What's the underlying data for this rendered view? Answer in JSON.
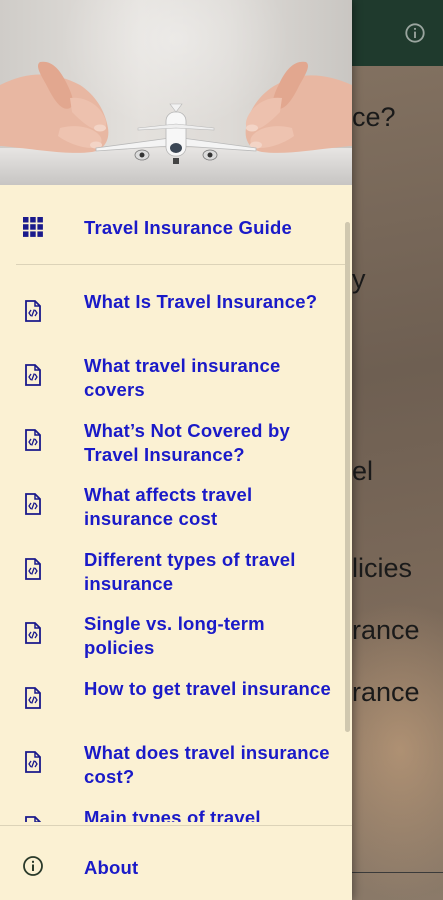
{
  "background": {
    "lines": [
      "ce?",
      "y",
      "el",
      "licies",
      "rance",
      "rance"
    ]
  },
  "drawer": {
    "header_image": "hands-protecting-airplane",
    "guide_item": {
      "label": "Travel Insurance Guide",
      "icon": "grid-icon"
    },
    "items": [
      {
        "label": "What Is Travel Insurance?",
        "icon": "code-file-icon"
      },
      {
        "label": "What travel insurance covers",
        "icon": "code-file-icon"
      },
      {
        "label": "What’s Not Covered by Travel Insurance?",
        "icon": "code-file-icon"
      },
      {
        "label": "What affects travel insurance cost",
        "icon": "code-file-icon"
      },
      {
        "label": "Different types of travel insurance",
        "icon": "code-file-icon"
      },
      {
        "label": "Single vs. long-term policies",
        "icon": "code-file-icon"
      },
      {
        "label": "How to get travel insurance",
        "icon": "code-file-icon"
      },
      {
        "label": "What does travel insurance cost?",
        "icon": "code-file-icon"
      },
      {
        "label": "Main types of travel",
        "icon": "code-file-icon"
      }
    ],
    "about_item": {
      "label": "About",
      "icon": "info-icon"
    }
  },
  "colors": {
    "drawer_bg": "#fbf1d3",
    "link_text": "#1a1ac8",
    "icon": "#1a1a8c",
    "appbar": "#1f3a2d"
  }
}
